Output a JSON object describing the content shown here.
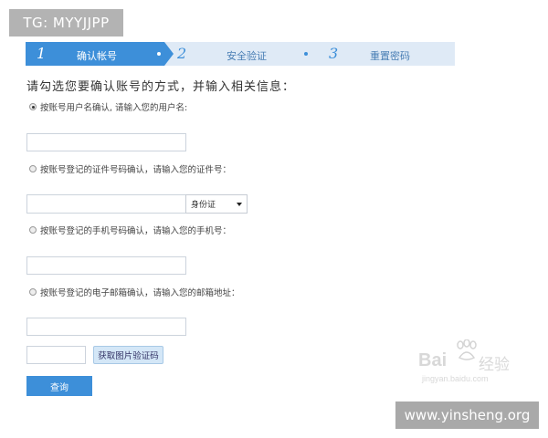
{
  "overlay": {
    "top_left_tag": "TG: MYYJJPP",
    "bottom_right_tag": "www.yinsheng.org"
  },
  "steps": [
    {
      "number": "1",
      "label": "确认帐号",
      "active": true
    },
    {
      "number": "2",
      "label": "安全验证",
      "active": false
    },
    {
      "number": "3",
      "label": "重置密码",
      "active": false
    }
  ],
  "heading": "请勾选您要确认账号的方式，并输入相关信息：",
  "options": [
    {
      "label": "按账号用户名确认, 请输入您的用户名:",
      "selected": true
    },
    {
      "label": "按账号登记的证件号码确认，请输入您的证件号：",
      "selected": false
    },
    {
      "label": "按账号登记的手机号码确认，请输入您的手机号：",
      "selected": false
    },
    {
      "label": "按账号登记的电子邮箱确认，请输入您的邮箱地址：",
      "selected": false
    }
  ],
  "id_type_select": {
    "selected": "身份证"
  },
  "captcha_button": "获取图片验证码",
  "submit_button": "查询",
  "watermark": {
    "brand": "Bai",
    "suffix": "经验",
    "url": "jingyan.baidu.com"
  },
  "colors": {
    "accent": "#3d8fd9",
    "stepbar_bg": "#dfeaf6"
  }
}
